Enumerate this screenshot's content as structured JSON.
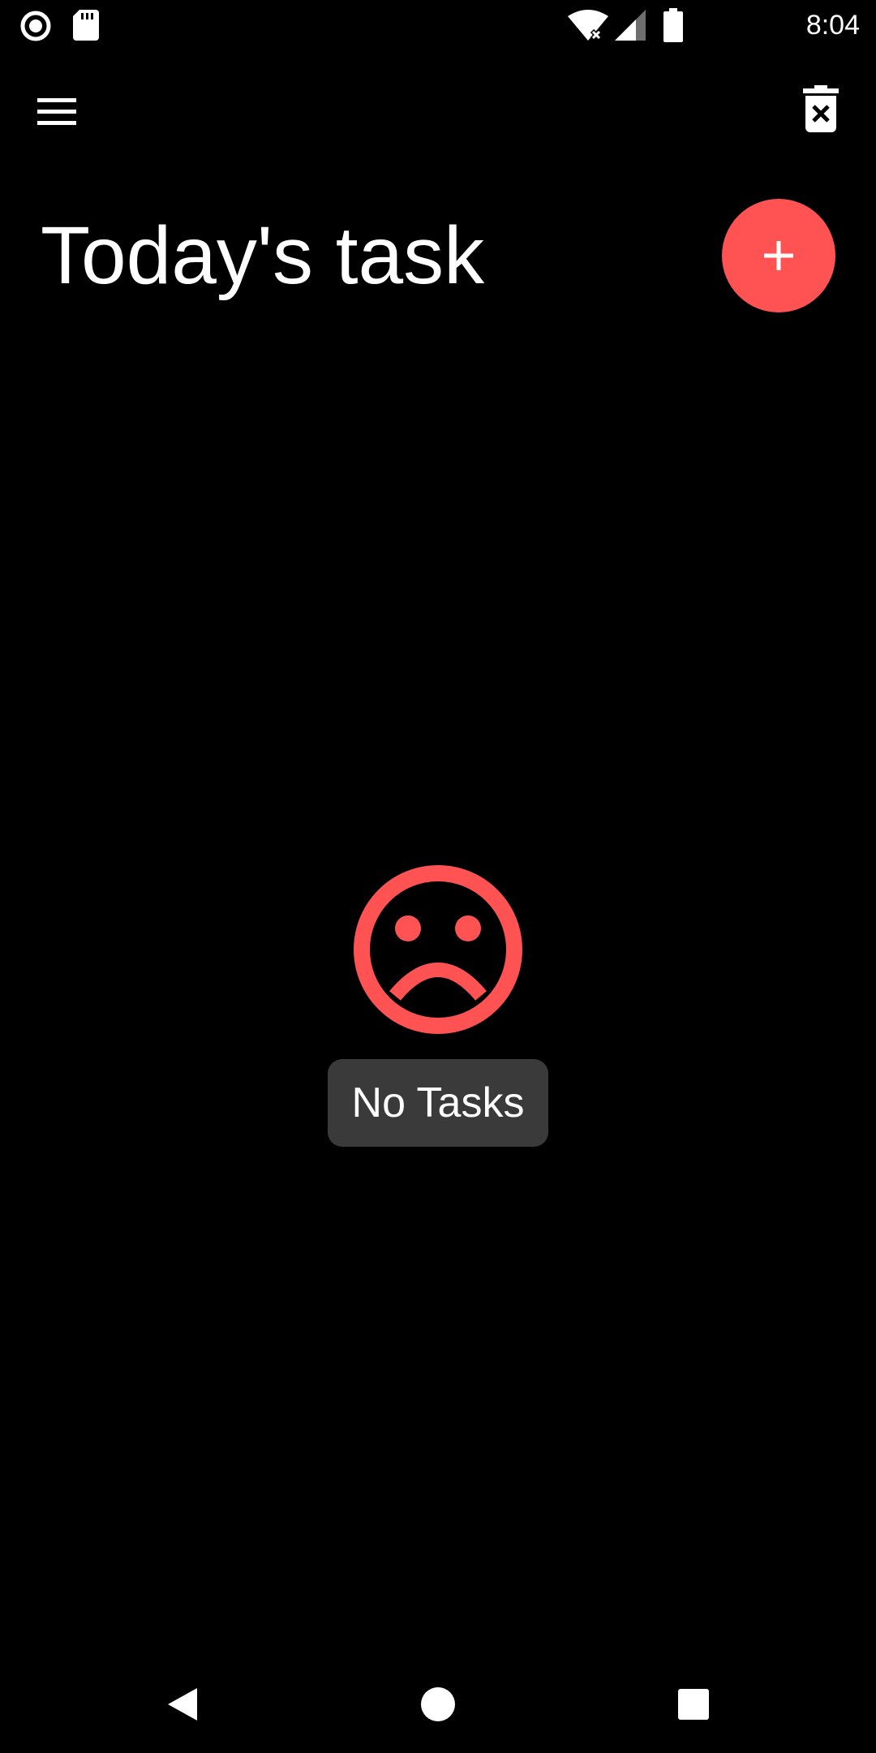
{
  "status_bar": {
    "time": "8:04",
    "icons": [
      "record-icon",
      "sd-card-icon",
      "wifi-no-internet-icon",
      "cell-signal-icon",
      "battery-icon"
    ]
  },
  "app_bar": {
    "menu_icon": "hamburger-menu-icon",
    "delete_icon": "delete-all-icon"
  },
  "header": {
    "title": "Today's task"
  },
  "fab": {
    "icon": "plus-icon"
  },
  "empty_state": {
    "icon": "sad-face-icon",
    "message": "No Tasks"
  },
  "nav_bar": {
    "icons": [
      "back-icon",
      "home-icon",
      "recents-icon"
    ]
  },
  "colors": {
    "background": "#000000",
    "accent": "#FF5252",
    "text": "#FFFFFF",
    "label_background": "#3A3A3A"
  }
}
